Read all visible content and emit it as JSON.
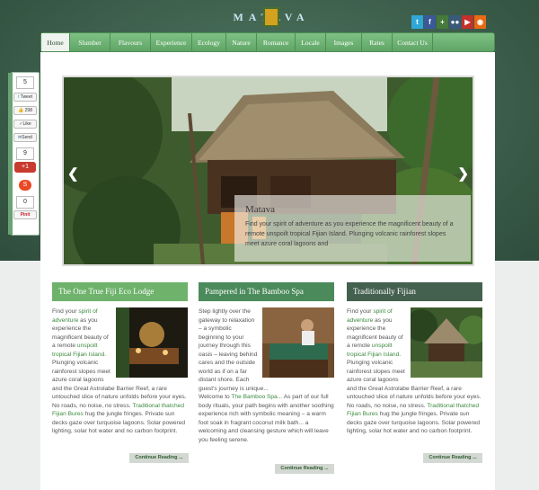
{
  "header": {
    "logo_text": "MATAVA"
  },
  "social_icons": [
    {
      "name": "twitter-icon",
      "glyph": "t",
      "color": "#2fa8d8"
    },
    {
      "name": "facebook-icon",
      "glyph": "f",
      "color": "#3b5998"
    },
    {
      "name": "google-plus-icon",
      "glyph": "+",
      "color": "#457a3a"
    },
    {
      "name": "flickr-icon",
      "glyph": "●●",
      "color": "#3a5a7a"
    },
    {
      "name": "youtube-icon",
      "glyph": "▶",
      "color": "#c4302b"
    },
    {
      "name": "rss-icon",
      "glyph": "◉",
      "color": "#e86a13"
    }
  ],
  "nav": [
    "Home",
    "Slumber",
    "Flavours",
    "Experience",
    "Ecology",
    "Nature",
    "Romance",
    "Locale",
    "Images",
    "Rates",
    "Contact Us"
  ],
  "share": {
    "top_count": "5",
    "tweet": "Tweet",
    "fb_like": "298",
    "like": "Like",
    "send": "Send",
    "plus_count": "9",
    "plus": "+1",
    "stumble_count": "0",
    "pin": "Pinit",
    "side_label": "SHARE"
  },
  "slider": {
    "title": "Matava",
    "text": "Find your spirit of adventure as you experience the magnificent beauty of a remote unspoilt tropical Fijian Island. Plunging volcanic rainforest slopes meet azure coral lagoons and"
  },
  "columns": [
    {
      "title": "The One True Fiji Eco Lodge",
      "head_color": "#6eb26c",
      "p1_g1": "spirit of adventure",
      "p1_a": "Find your ",
      "p1_b": " as you experience the magnificent beauty of a remote ",
      "p1_g2": "unspoilt tropical Fijian Island",
      "p1_c": ". Plunging volcanic rainforest slopes meet azure coral lagoons and the Great Astrolabe Barrier Reef, a rare untouched slice of nature unfolds before your eyes.",
      "p2": "No roads, no noise, no stress. ",
      "p2_g": "Traditional thatched Fijian Bures",
      "p2_b": " hug the jungle fringes. Private sun decks gaze over turquoise lagoons. Solar powered lighting, solar hot water and no carbon footprint.",
      "more": "Continue Reading ..."
    },
    {
      "title": "Pampered in The Bamboo Spa",
      "head_color": "#4b8a5a",
      "p1_a": "Step lightly over the gateway to relaxation – a symbolic beginning to your journey through this oasis – leaving behind cares and the outside world as if on a far distant shore. Each guest's journey is unique...",
      "p1_g1": "",
      "p1_b": "",
      "p1_g2": "",
      "p1_c": "",
      "p2": "Welcome to ",
      "p2_g": "The Bamboo Spa...",
      "p2_b": " As part of our full body rituals, your path begins with another soothing experience rich with symbolic meaning – a warm foot soak in fragrant coconut milk bath... a welcoming and cleansing gesture which will leave you feeling serene.",
      "more": "Continue Reading ..."
    },
    {
      "title": "Traditionally Fijian",
      "head_color": "#44604f",
      "p1_g1": "spirit of adventure",
      "p1_a": "Find your ",
      "p1_b": " as you experience the magnificent beauty of a remote ",
      "p1_g2": "unspoilt tropical Fijian Island",
      "p1_c": ". Plunging volcanic rainforest slopes meet azure coral lagoons and the Great Astrolabe Barrier Reef, a rare untouched slice of nature unfolds before your eyes.",
      "p2": "No roads, no noise, no stress. ",
      "p2_g": "Traditional thatched Fijian Bures",
      "p2_b": " hug the jungle fringes. Private sun decks gaze over turquoise lagoons. Solar powered lighting, solar hot water and no carbon footprint.",
      "more": "Continue Reading ..."
    }
  ]
}
